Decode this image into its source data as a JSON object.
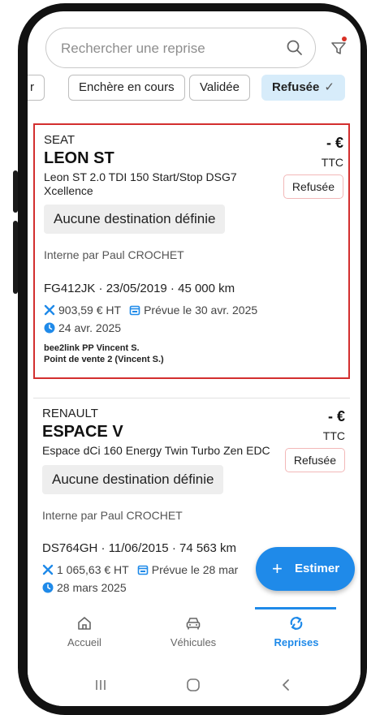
{
  "search": {
    "placeholder": "Rechercher une reprise"
  },
  "filters": {
    "chips": [
      {
        "label": "r"
      },
      {
        "label": "Enchère en cours"
      },
      {
        "label": "Validée"
      },
      {
        "label": "Refusée",
        "check": "✓",
        "active": true
      }
    ]
  },
  "cards": [
    {
      "brand": "SEAT",
      "model": "LEON ST",
      "version": "Leon ST 2.0 TDI 150 Start/Stop DSG7 Xcellence",
      "price": "- €",
      "tax": "TTC",
      "status": "Refusée",
      "destination": "Aucune destination définie",
      "owner": "Interne par Paul CROCHET",
      "vehicle_meta": "FG412JK · 23/05/2019 · 45 000 km",
      "repair_cost": "903,59 € HT",
      "planned": "Prévue le 30 avr. 2025",
      "date": "24 avr. 2025",
      "site_line1": "bee2link PP Vincent S.",
      "site_line2": "Point de vente 2 (Vincent S.)"
    },
    {
      "brand": "RENAULT",
      "model": "ESPACE V",
      "version": "Espace dCi 160 Energy Twin Turbo Zen EDC",
      "price": "- €",
      "tax": "TTC",
      "status": "Refusée",
      "destination": "Aucune destination définie",
      "owner": "Interne par Paul CROCHET",
      "vehicle_meta": "DS764GH · 11/06/2015 · 74 563 km",
      "repair_cost": "1 065,63 € HT",
      "planned": "Prévue le 28 mar",
      "date": "28 mars 2025"
    }
  ],
  "fab": {
    "label": "Estimer",
    "plus": "+"
  },
  "nav": {
    "items": [
      {
        "label": "Accueil",
        "icon": "home-icon"
      },
      {
        "label": "Véhicules",
        "icon": "car-icon"
      },
      {
        "label": "Reprises",
        "icon": "sync-icon",
        "active": true
      }
    ]
  },
  "colors": {
    "accent": "#1f8ae9",
    "selected_border": "#d32f2f",
    "chip_active": "#d7ecfa"
  }
}
